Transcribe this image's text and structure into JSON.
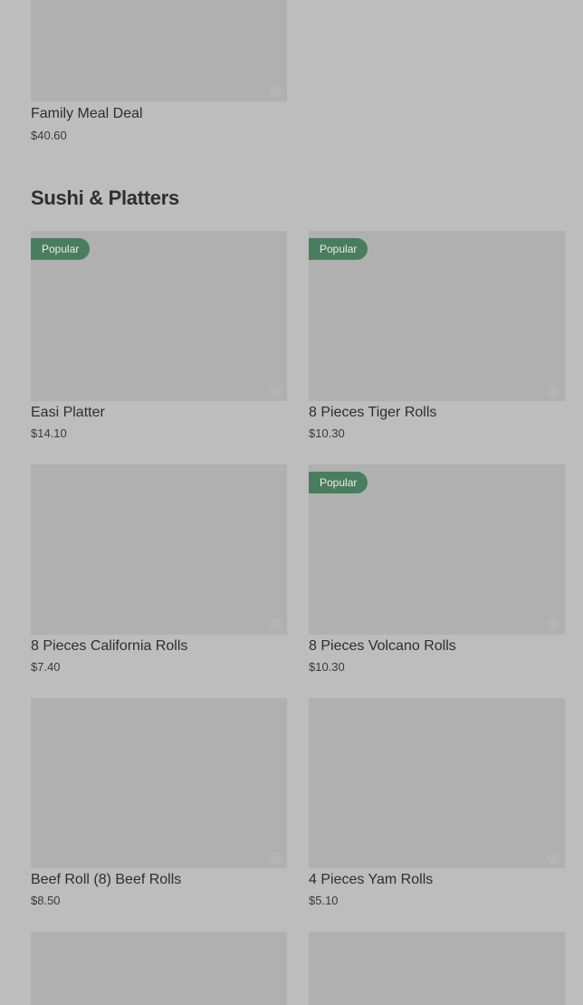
{
  "colors": {
    "background": "#bdbdbd",
    "image_placeholder": "#b0b0b0",
    "badge": "#4a7d5d",
    "text": "#2e2e2e"
  },
  "top_item": {
    "name": "Family Meal Deal",
    "price": "$40.60"
  },
  "section": {
    "title": "Sushi & Platters",
    "items": [
      {
        "name": "Easi Platter",
        "price": "$14.10",
        "badge": "Popular"
      },
      {
        "name": "8 Pieces Tiger Rolls",
        "price": "$10.30",
        "badge": "Popular"
      },
      {
        "name": "8 Pieces California Rolls",
        "price": "$7.40",
        "badge": ""
      },
      {
        "name": "8 Pieces Volcano Rolls",
        "price": "$10.30",
        "badge": "Popular"
      },
      {
        "name": "Beef Roll (8) Beef Rolls",
        "price": "$8.50",
        "badge": ""
      },
      {
        "name": "4 Pieces Yam Rolls",
        "price": "$5.10",
        "badge": ""
      }
    ]
  }
}
